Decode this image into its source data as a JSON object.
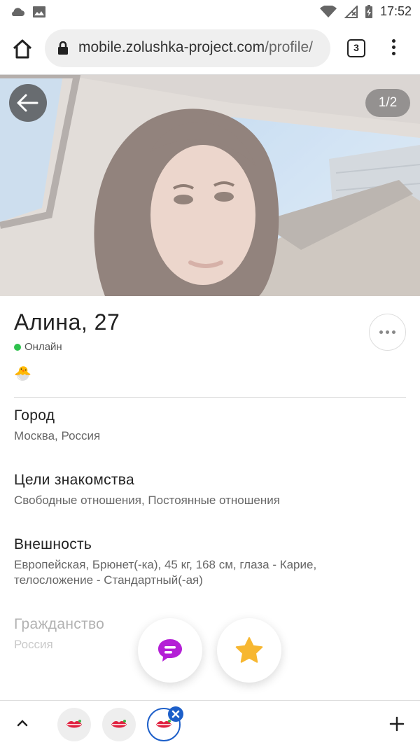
{
  "status_bar": {
    "time": "17:52",
    "icons": [
      "cloud-icon",
      "image-icon",
      "wifi-icon",
      "signal-off-icon",
      "battery-charging-icon"
    ]
  },
  "browser": {
    "url_host": "mobile.zolushka-project.com",
    "url_path": "/profile/",
    "tab_count": "3",
    "icons": [
      "home-icon",
      "lock-icon",
      "tabs-icon",
      "more-vert-icon"
    ]
  },
  "photo": {
    "counter": "1/2",
    "back_icon": "arrow-left-icon"
  },
  "profile": {
    "name": "Алина, 27",
    "status": "Онлайн",
    "badge_emoji": "🐣",
    "fields": [
      {
        "label": "Город",
        "value": "Москва, Россия"
      },
      {
        "label": "Цели знакомства",
        "value": "Свободные отношения, Постоянные отношения"
      },
      {
        "label": "Внешность",
        "value": "Европейская, Брюнет(-ка), 45 кг, 168 см, глаза - Карие, телосложение - Стандартный(-ая)"
      },
      {
        "label": "Гражданство",
        "value": "Россия"
      }
    ]
  },
  "actions": {
    "message_icon": "chat-bubble-icon",
    "favorite_icon": "star-icon"
  },
  "colors": {
    "online": "#2ec24d",
    "message": "#b41fd6",
    "star": "#f7b731",
    "accent": "#1d5fc9",
    "lips": "#e0213f"
  }
}
